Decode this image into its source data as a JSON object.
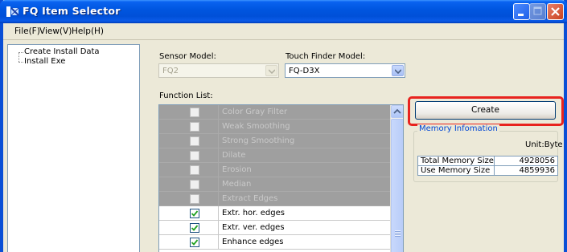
{
  "window": {
    "title": "FQ Item Selector"
  },
  "menu": [
    {
      "label": "File(F)"
    },
    {
      "label": "View(V)"
    },
    {
      "label": "Help(H)"
    }
  ],
  "tree": {
    "items": [
      {
        "label": "Create Install Data"
      },
      {
        "label": "Install Exe"
      }
    ]
  },
  "sensor_model": {
    "label": "Sensor Model:",
    "value": "FQ2",
    "enabled": false
  },
  "touch_finder_model": {
    "label": "Touch Finder Model:",
    "value": "FQ-D3X",
    "enabled": true
  },
  "function_list": {
    "label": "Function List:",
    "items": [
      {
        "name": "Color Gray Filter",
        "checked": false,
        "enabled": false
      },
      {
        "name": "Weak Smoothing",
        "checked": false,
        "enabled": false
      },
      {
        "name": "Strong Smoothing",
        "checked": false,
        "enabled": false
      },
      {
        "name": "Dilate",
        "checked": false,
        "enabled": false
      },
      {
        "name": "Erosion",
        "checked": false,
        "enabled": false
      },
      {
        "name": "Median",
        "checked": false,
        "enabled": false
      },
      {
        "name": "Extract Edges",
        "checked": false,
        "enabled": false
      },
      {
        "name": "Extr. hor. edges",
        "checked": true,
        "enabled": true
      },
      {
        "name": "Extr. ver. edges",
        "checked": true,
        "enabled": true
      },
      {
        "name": "Enhance edges",
        "checked": true,
        "enabled": true
      }
    ]
  },
  "create_button": {
    "label": "Create"
  },
  "memory": {
    "title": "Memory Infomation",
    "unit": "Unit:Byte",
    "rows": [
      {
        "label": "Total Memory Size",
        "value": "4928056"
      },
      {
        "label": "Use Memory Size",
        "value": "4859936"
      }
    ]
  },
  "colors": {
    "titlebar": "#0054e3",
    "highlight": "#e8231e",
    "group_title": "#0046d5",
    "disabled_row": "#9f9f9f",
    "check": "#21a121"
  }
}
